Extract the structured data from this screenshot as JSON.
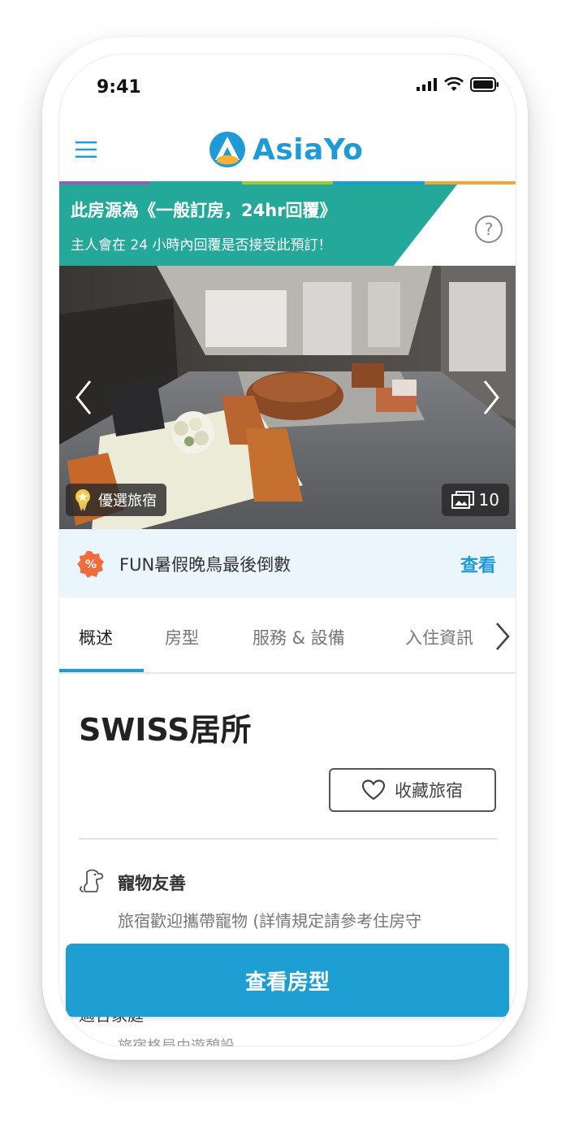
{
  "status_bar": {
    "time": "9:41"
  },
  "header": {
    "logo_text": "AsiaYo"
  },
  "brand_strip_colors": [
    "#8e5fb3",
    "#23a89a",
    "#9cc93a",
    "#1e9bd7",
    "#f0a63a"
  ],
  "notice": {
    "title": "此房源為《一般訂房，24hr回覆》",
    "subtitle": "主人會在 24 小時內回覆是否接受此預訂！",
    "color": "#23a89a"
  },
  "hero": {
    "badge_label": "優選旅宿",
    "photo_count": "10"
  },
  "promo": {
    "icon_text": "%",
    "text": "FUN暑假晚鳥最後倒數",
    "link": "查看"
  },
  "tabs": [
    {
      "label": "概述",
      "active": true
    },
    {
      "label": "房型"
    },
    {
      "label": "服務 & 設備"
    },
    {
      "label": "入住資訊"
    }
  ],
  "property": {
    "title": "SWISS居所",
    "favorite_label": "收藏旅宿"
  },
  "features": [
    {
      "icon": "pet-icon",
      "title": "寵物友善",
      "description": "旅宿歡迎攜帶寵物 (詳情規定請參考住房守"
    }
  ],
  "partially_hidden": {
    "row1": "適合家庭",
    "row2": "旅宿格局由遊憩設"
  },
  "cta": {
    "label": "查看房型",
    "color": "#1e9fd4"
  },
  "accent_color": "#1e9bd7"
}
